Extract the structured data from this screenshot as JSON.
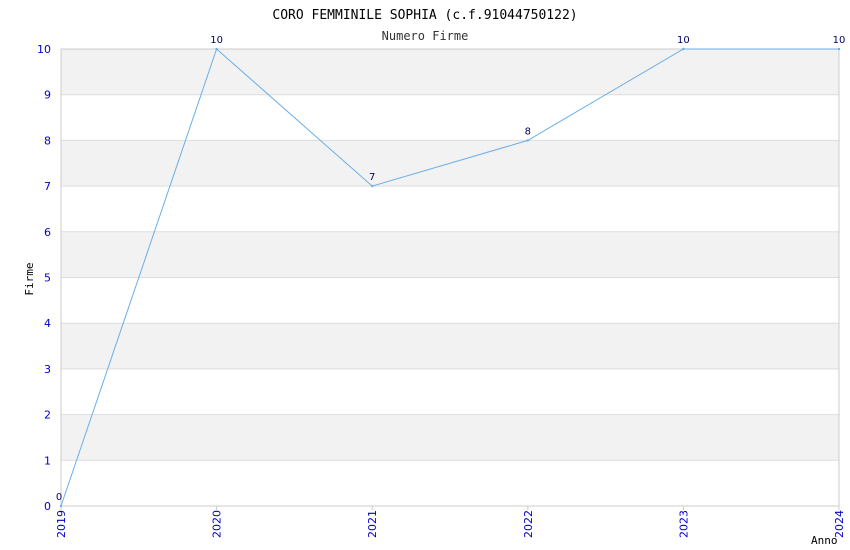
{
  "chart_data": {
    "type": "line",
    "title": "CORO FEMMINILE SOPHIA (c.f.91044750122)",
    "subtitle": "Numero Firme",
    "xlabel": "Anno",
    "ylabel": "Firme",
    "x": [
      "2019",
      "2020",
      "2021",
      "2022",
      "2023",
      "2024"
    ],
    "series": [
      {
        "values": [
          0,
          10,
          7,
          8,
          10,
          10
        ]
      }
    ],
    "ylim": [
      0,
      10
    ],
    "y_ticks": [
      "0",
      "1",
      "2",
      "3",
      "4",
      "5",
      "6",
      "7",
      "8",
      "9",
      "10"
    ],
    "grid": true,
    "line_color": "#6aaee8",
    "band_color": "#f2f2f2",
    "tick_color": "#0000cc"
  }
}
